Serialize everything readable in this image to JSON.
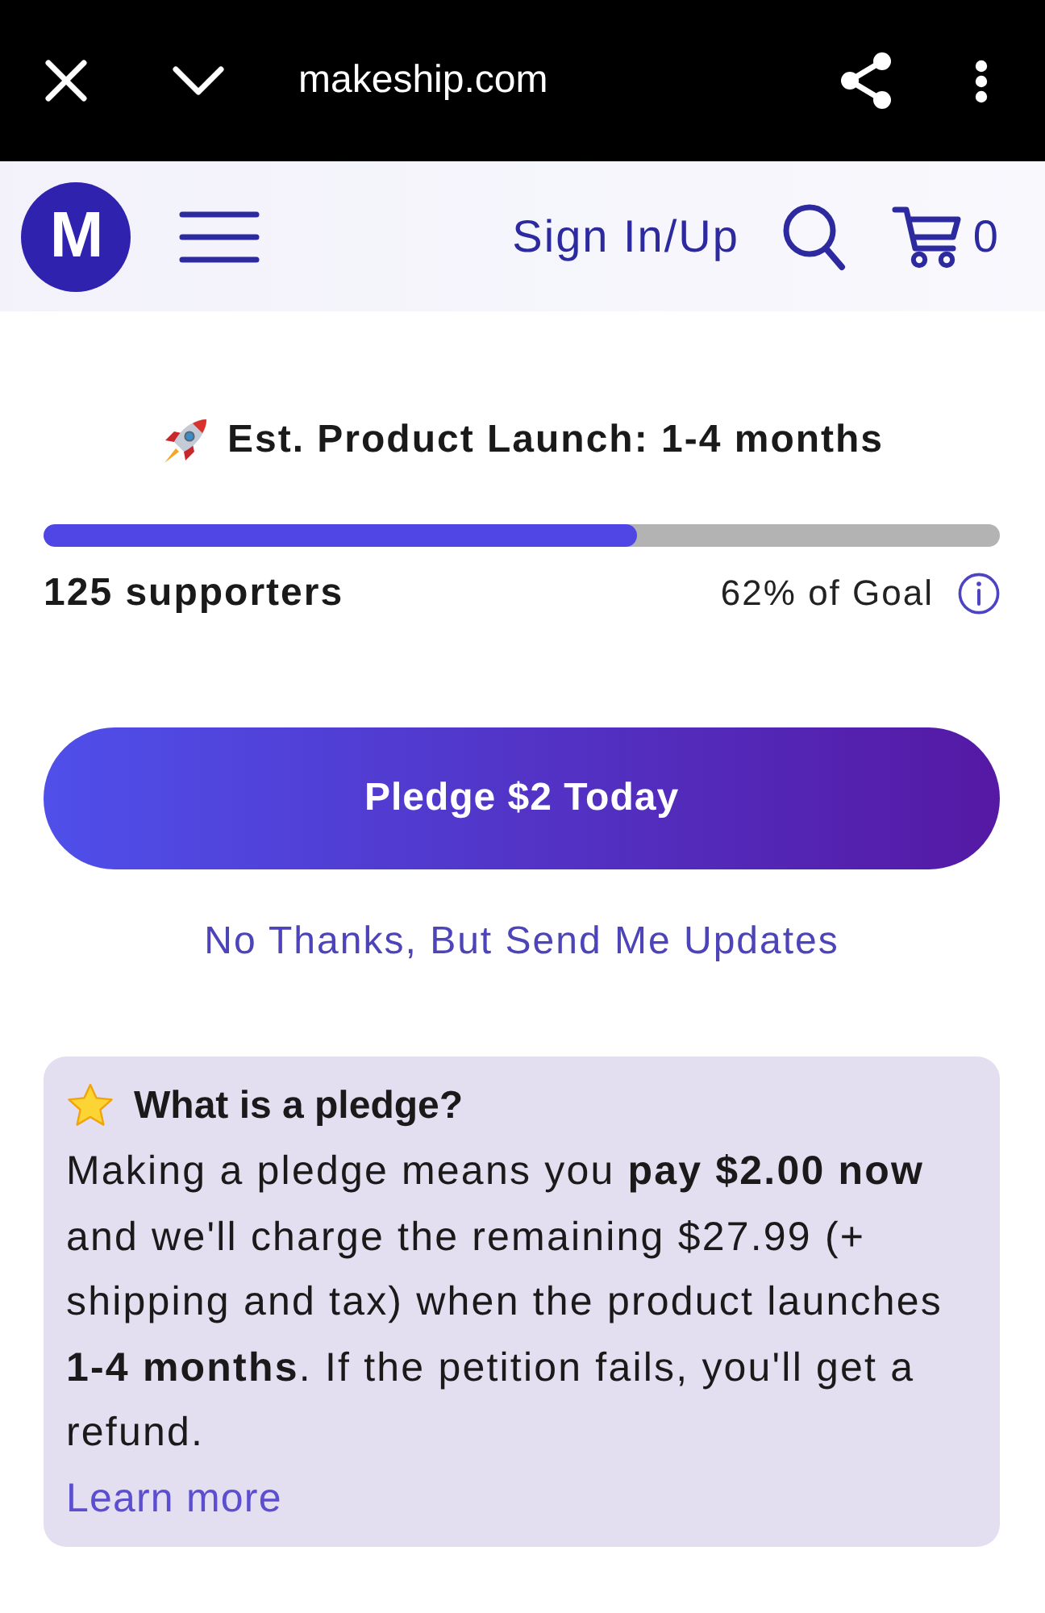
{
  "browser_bar": {
    "url": "makeship.com"
  },
  "site_header": {
    "logo_letter": "M",
    "sign_in": "Sign In/Up",
    "cart_count": "0"
  },
  "campaign": {
    "launch_estimate": "Est. Product Launch: 1-4 months",
    "progress": {
      "level": 0.62
    },
    "supporters": "125 supporters",
    "goal_reading": "62% of Goal"
  },
  "actions": {
    "primary_button": "Pledge $2 Today",
    "secondary_link": "No Thanks, But Send Me Updates"
  },
  "info_card": {
    "title": "What is a pledge?",
    "body": "Making a pledge means you **pay $2.00 now** and we'll charge the remaining $27.99 (+ shipping and tax) when the product launches **1-4 months**. If the petition fails, you'll get a refund.",
    "link": "Learn more"
  }
}
